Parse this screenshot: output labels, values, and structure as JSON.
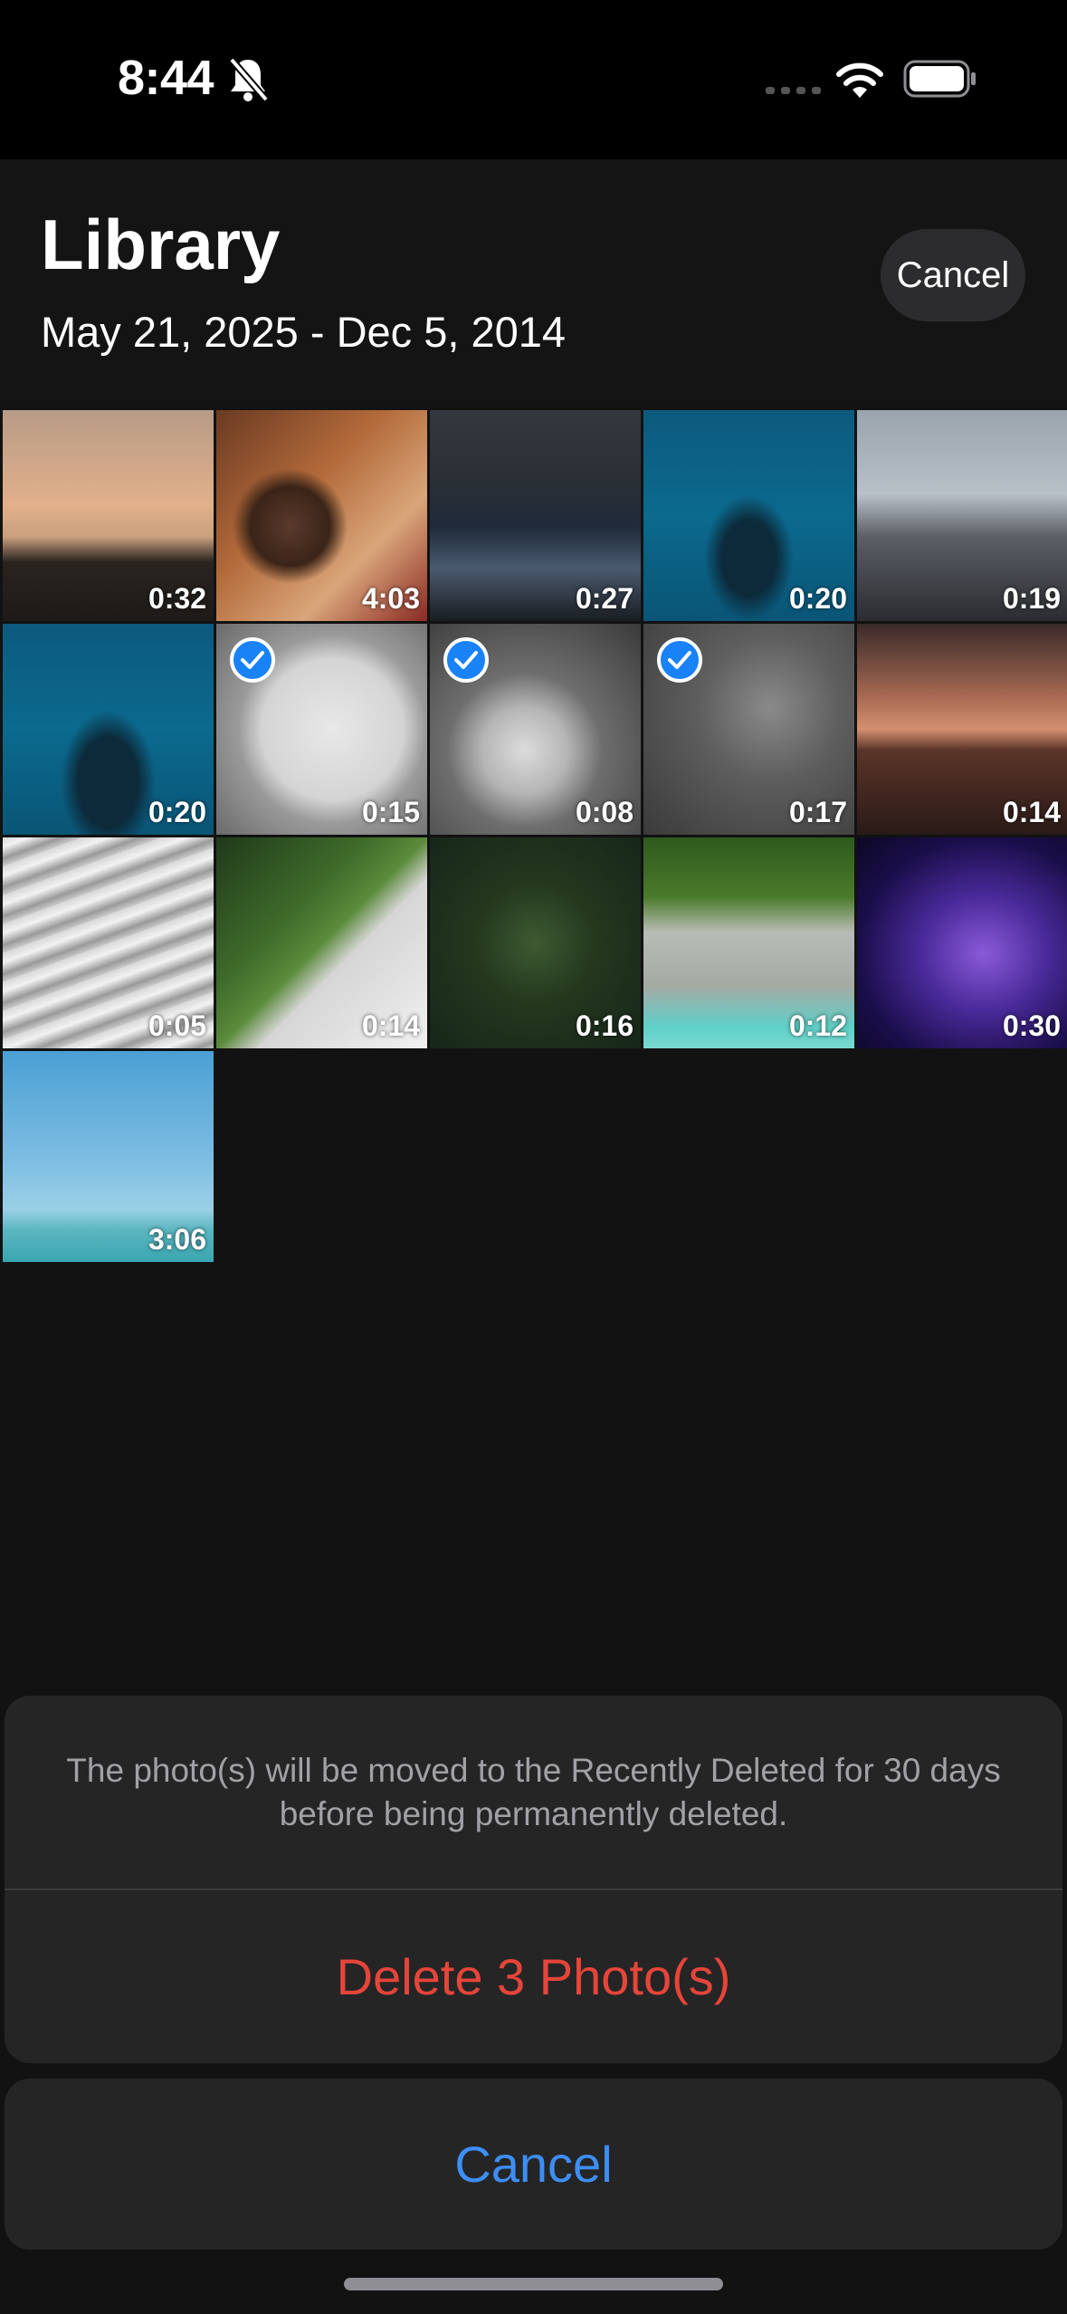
{
  "status_bar": {
    "time": "8:44",
    "icons": [
      "bell-slash-icon",
      "cellular-signal-icon",
      "wifi-icon",
      "battery-icon"
    ]
  },
  "header": {
    "title": "Library",
    "date_range": "May 21, 2025 - Dec 5, 2014",
    "cancel_label": "Cancel"
  },
  "grid": {
    "items": [
      {
        "duration": "0:32",
        "selected": false,
        "scene": "sunset over coast"
      },
      {
        "duration": "4:03",
        "selected": false,
        "scene": "child with christmas lights"
      },
      {
        "duration": "0:27",
        "selected": false,
        "scene": "city at night"
      },
      {
        "duration": "0:20",
        "selected": false,
        "scene": "whales aerial"
      },
      {
        "duration": "0:19",
        "selected": false,
        "scene": "crowd in plaza"
      },
      {
        "duration": "0:20",
        "selected": false,
        "scene": "whales aerial"
      },
      {
        "duration": "0:15",
        "selected": true,
        "scene": "plate with note"
      },
      {
        "duration": "0:08",
        "selected": true,
        "scene": "bunny black and white"
      },
      {
        "duration": "0:17",
        "selected": true,
        "scene": "milky way"
      },
      {
        "duration": "0:14",
        "selected": false,
        "scene": "mountain at dusk"
      },
      {
        "duration": "0:05",
        "selected": false,
        "scene": "abstract waves"
      },
      {
        "duration": "0:14",
        "selected": false,
        "scene": "green mountain ridge"
      },
      {
        "duration": "0:16",
        "selected": false,
        "scene": "palm forest aerial"
      },
      {
        "duration": "0:12",
        "selected": false,
        "scene": "tropical coast aerial"
      },
      {
        "duration": "0:30",
        "selected": false,
        "scene": "purple particles"
      },
      {
        "duration": "3:06",
        "selected": false,
        "scene": "blue sky ocean"
      }
    ]
  },
  "action_sheet": {
    "message": "The photo(s) will be moved to the Recently Deleted for 30 days before being permanently deleted.",
    "delete_label": "Delete 3 Photo(s)",
    "cancel_label": "Cancel"
  },
  "colors": {
    "destructive": "#e5453a",
    "accent": "#3d8ef5",
    "selection": "#1a82f7"
  }
}
